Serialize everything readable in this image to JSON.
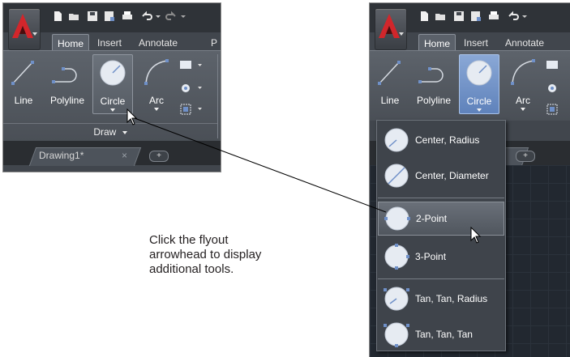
{
  "ribbon": {
    "tabs": [
      "Home",
      "Insert",
      "Annotate",
      "P"
    ],
    "tools": {
      "line": "Line",
      "polyline": "Polyline",
      "circle": "Circle",
      "arc": "Arc"
    },
    "panel_name": "Draw"
  },
  "file_tab": {
    "name": "Drawing1*",
    "close": "×",
    "new": "+"
  },
  "circle_flyout": {
    "items": [
      "Center, Radius",
      "Center, Diameter",
      "2-Point",
      "3-Point",
      "Tan, Tan, Radius",
      "Tan, Tan, Tan"
    ],
    "hovered": "2-Point"
  },
  "caption": {
    "lines": [
      "Click the flyout",
      "arrowhead to display",
      "additional tools."
    ]
  },
  "colors": {
    "app_red": "#d2262b",
    "ribbon_dark": "#41464d",
    "circle_pressed": "#6f90c8",
    "drawing_bg": "#222830"
  }
}
